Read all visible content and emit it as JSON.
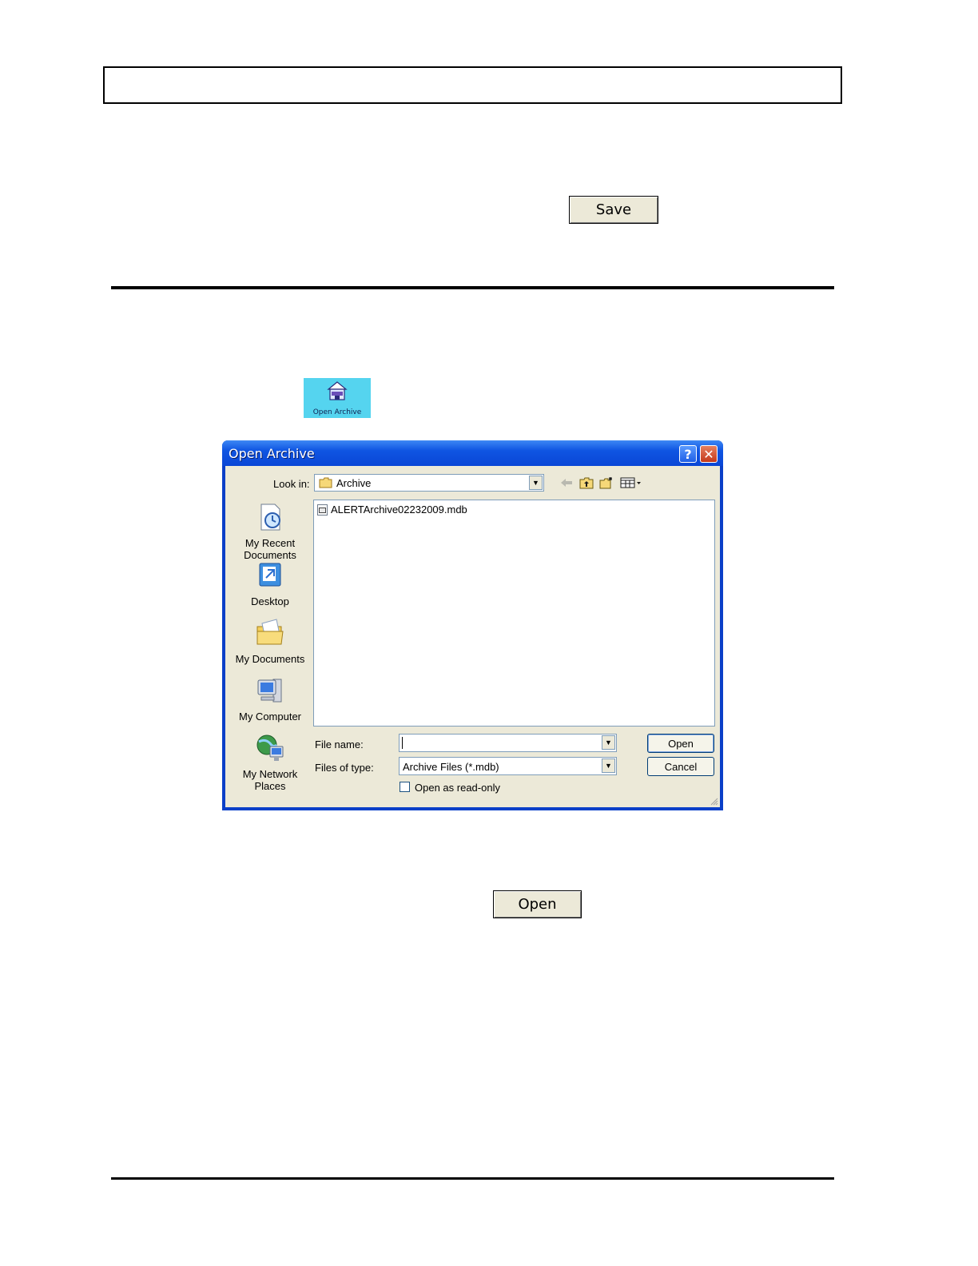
{
  "document": {
    "save_button": "Save",
    "toolbar_icon_label": "Open Archive",
    "open_button": "Open"
  },
  "dialog": {
    "title": "Open Archive",
    "help_glyph": "?",
    "close_glyph": "✕",
    "look_in_label": "Look in:",
    "look_in_value": "Archive",
    "places": [
      {
        "label_line1": "My Recent",
        "label_line2": "Documents"
      },
      {
        "label_line1": "Desktop",
        "label_line2": ""
      },
      {
        "label_line1": "My Documents",
        "label_line2": ""
      },
      {
        "label_line1": "My Computer",
        "label_line2": ""
      },
      {
        "label_line1": "My Network",
        "label_line2": "Places"
      }
    ],
    "files": [
      "ALERTArchive02232009.mdb"
    ],
    "file_name_label": "File name:",
    "file_name_value": "",
    "files_of_type_label": "Files of type:",
    "files_of_type_value": "Archive Files (*.mdb)",
    "read_only_label": "Open as read-only",
    "read_only_checked": false,
    "open_button": "Open",
    "cancel_button": "Cancel"
  },
  "colors": {
    "titlebar": "#0a46d6",
    "dialog_face": "#ece9d8",
    "toolbar_icon_bg": "#55d4ef"
  }
}
